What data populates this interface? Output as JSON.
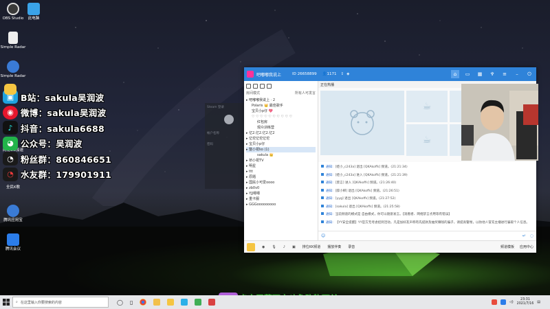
{
  "desktop": {
    "icons": [
      {
        "label": "OBS Studio",
        "icon": "obs-icon",
        "color": "#3a3a3a"
      },
      {
        "label": "此电脑",
        "icon": "computer-icon",
        "color": "#3aa3e8"
      },
      {
        "label": "Simple Radar",
        "icon": "file-icon",
        "color": "#eeeeee"
      },
      {
        "label": "Simple Radar",
        "icon": "zip-icon",
        "color": "#3a7bd5"
      },
      {
        "label": "腾讯会议",
        "icon": "meeting-icon",
        "color": "#2b7de9"
      },
      {
        "label": "网易UU加速",
        "icon": "uu-icon",
        "color": "#f5c542"
      },
      {
        "label": "腾讯应用宝",
        "icon": "zip-icon",
        "color": "#3a7bd5"
      },
      {
        "label": "全民K歌",
        "icon": "karaoke-icon",
        "color": "#e83a3a"
      }
    ]
  },
  "social": [
    {
      "icon": "bilibili-icon",
      "text": "B站：sakula吴润波",
      "color": "#1fa3e0"
    },
    {
      "icon": "weibo-icon",
      "text": "微博：sakula吴润波",
      "color": "#e6162d"
    },
    {
      "icon": "douyin-icon",
      "text": "抖音：sakula6688",
      "color": "#111111"
    },
    {
      "icon": "wechat-icon",
      "text": "公众号：吴润波",
      "color": "#22b34a"
    },
    {
      "icon": "qq-icon",
      "text": "粉丝群：860846651",
      "color": "#1a1a1a"
    },
    {
      "icon": "qq-icon",
      "text": "水友群：179901911",
      "color": "#1a1a1a"
    }
  ],
  "steam": {
    "title": "Steam 登录",
    "account_label": "帐户名称",
    "password_label": "密码"
  },
  "yy": {
    "channel_name": "吧嘟嘟我说上",
    "channel_id": "ID 26658899",
    "online_count": "1171",
    "left_mode": "房间模式",
    "left_more": "所有人可发言",
    "tree": [
      {
        "text": "吧嘟嘟我说上 · 2",
        "indent": 0,
        "sel": false
      },
      {
        "text": "Polaris 👑  最佳歌手",
        "indent": 1,
        "sel": false
      },
      {
        "text": "宝贝小p仔 💖",
        "indent": 1,
        "sel": false
      },
      {
        "text": "♡ ♡ ♡ ♡ ♡ ♡ ♡ ♡ ♡ ♡",
        "indent": 1,
        "sel": false
      },
      {
        "text": "红包房",
        "indent": 2,
        "sel": false
      },
      {
        "text": "观众训练营",
        "indent": 2,
        "sel": false
      },
      {
        "text": "亿2.亿2.亿2.亿2",
        "indent": 0,
        "sel": false
      },
      {
        "text": "亿佗亿佗亿佗",
        "indent": 0,
        "sel": false
      },
      {
        "text": "宝贝小p仔",
        "indent": 0,
        "sel": false
      },
      {
        "text": "整小祝ko (1)",
        "indent": 0,
        "sel": true
      },
      {
        "text": "sakula 👑",
        "indent": 2,
        "sel": false
      },
      {
        "text": "桥小祝TV",
        "indent": 0,
        "sel": false
      },
      {
        "text": "明星",
        "indent": 0,
        "sel": false
      },
      {
        "text": "ttt",
        "indent": 0,
        "sel": false
      },
      {
        "text": "原题",
        "indent": 0,
        "sel": false
      },
      {
        "text": "国民小可爱oooo",
        "indent": 0,
        "sel": false
      },
      {
        "text": "zb0v0",
        "indent": 0,
        "sel": false
      },
      {
        "text": "YJJ嗯嗯",
        "indent": 0,
        "sel": false
      },
      {
        "text": "重卡服",
        "indent": 0,
        "sel": false
      },
      {
        "text": "GGGooooooooo",
        "indent": 0,
        "sel": false
      }
    ],
    "live_title": "正在热播",
    "chat": [
      {
        "prefix": "通知:",
        "text": "[娃小_c243a] 退出 [QKAkoffs] 频道。(21:21:34)"
      },
      {
        "prefix": "通知:",
        "text": "[娃小_c243a] 进入 [QKAkoffs] 频道。(21:21:39)"
      },
      {
        "prefix": "通知:",
        "text": "[莫言] 进入 [QKAkoffs] 频道。(21:26:40)"
      },
      {
        "prefix": "通知:",
        "text": "[醉小柳] 退出 [QKAkoffs] 频道。(21:26:51)"
      },
      {
        "prefix": "通知:",
        "text": "[yyg] 退出 [QKAkoffs] 频道。(21:27:52)"
      },
      {
        "prefix": "通知:",
        "text": "[sakula] 退出 [QKAkoffs] 频道。(21:25:58)"
      },
      {
        "prefix": "通知:",
        "text": "当前频道的模式是 自由模式，你可以随意发言。【观看者、网络禁言点用等有错误】"
      },
      {
        "prefix": "通知:",
        "text": "【YY安全提醒】YY官方无考虑招到活动，凡是加好友声称有先提款及抽奖赚钱的骗子，请提高警惕，以防他人冒充主播进行骗取个人信息。"
      }
    ],
    "bottom_left": [
      "排位KK频道",
      "播放伴奏",
      "录音"
    ],
    "bottom_right": [
      "频道模板",
      "应用中心"
    ]
  },
  "taskbar": {
    "search_placeholder": "在这里输入你要搜索的内容",
    "time": "23:31",
    "date": "2021/7/16"
  },
  "subtitle": {
    "badge": "斗鱼",
    "text": "点击屏幕下方斗鱼购物下单"
  }
}
